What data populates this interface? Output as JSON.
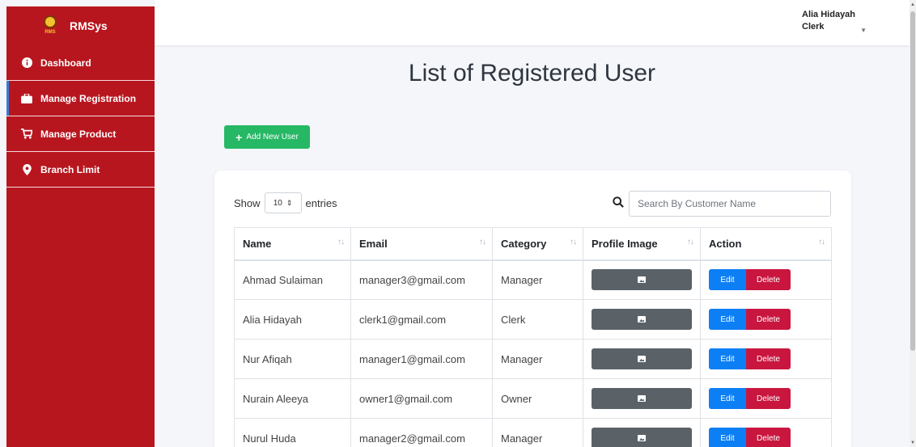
{
  "brand": {
    "name": "RMSys",
    "logo_text": "RMS"
  },
  "sidebar": {
    "items": [
      {
        "label": "Dashboard",
        "icon": "info-circle-icon"
      },
      {
        "label": "Manage Registration",
        "icon": "briefcase-icon",
        "active": true
      },
      {
        "label": "Manage Product",
        "icon": "cart-icon"
      },
      {
        "label": "Branch Limit",
        "icon": "map-pin-icon"
      }
    ]
  },
  "user": {
    "name": "Alia Hidayah",
    "role": "Clerk"
  },
  "page": {
    "title": "List of Registered User"
  },
  "toolbar": {
    "add_label": "Add New User"
  },
  "table_controls": {
    "show_label": "Show",
    "entries_value": "10",
    "entries_label": "entries",
    "search_placeholder": "Search By Customer Name"
  },
  "table": {
    "headers": [
      "Name",
      "Email",
      "Category",
      "Profile Image",
      "Action"
    ],
    "rows": [
      {
        "name": "Ahmad Sulaiman",
        "email": "manager3@gmail.com",
        "category": "Manager"
      },
      {
        "name": "Alia Hidayah",
        "email": "clerk1@gmail.com",
        "category": "Clerk"
      },
      {
        "name": "Nur Afiqah",
        "email": "manager1@gmail.com",
        "category": "Manager"
      },
      {
        "name": "Nurain Aleeya",
        "email": "owner1@gmail.com",
        "category": "Owner"
      },
      {
        "name": "Nurul Huda",
        "email": "manager2@gmail.com",
        "category": "Manager"
      }
    ],
    "edit_label": "Edit",
    "delete_label": "Delete"
  },
  "colors": {
    "sidebar": "#b8161f",
    "add": "#26b865",
    "edit": "#0d7ff5",
    "delete": "#c9163f",
    "image": "#5a6268"
  }
}
